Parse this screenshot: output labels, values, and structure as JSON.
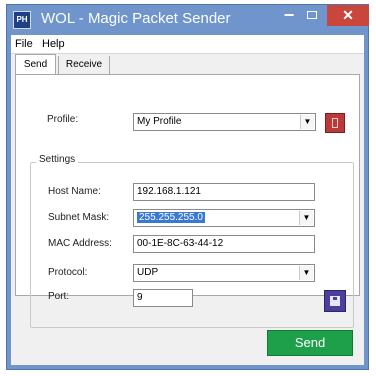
{
  "window": {
    "title": "WOL - Magic Packet Sender",
    "app_icon_text": "PH"
  },
  "controls": {
    "minimize": "−",
    "close": "✕"
  },
  "menu": {
    "items": [
      "File",
      "Help"
    ]
  },
  "tabs": [
    {
      "label": "Send",
      "active": true
    },
    {
      "label": "Receive",
      "active": false
    }
  ],
  "profile": {
    "label": "Profile:",
    "value": "My Profile"
  },
  "settings": {
    "title": "Settings",
    "host_name": {
      "label": "Host Name:",
      "value": "192.168.1.121"
    },
    "subnet_mask": {
      "label": "Subnet Mask:",
      "value": "255.255.255.0"
    },
    "mac_address": {
      "label": "MAC Address:",
      "value": "00-1E-8C-63-44-12"
    },
    "protocol": {
      "label": "Protocol:",
      "value": "UDP"
    },
    "port": {
      "label": "Port:",
      "value": "9"
    }
  },
  "actions": {
    "send": "Send"
  },
  "colors": {
    "titlebar": "#6f95cc",
    "close": "#c9463d",
    "send": "#1ea04a",
    "save": "#4b3f9c",
    "profile_button": "#b83a3a",
    "selection": "#3a78d6"
  },
  "icons": {
    "profile_button": "delete-profile-icon",
    "save_button": "floppy-disk-icon",
    "combo_arrow": "chevron-down-icon"
  }
}
